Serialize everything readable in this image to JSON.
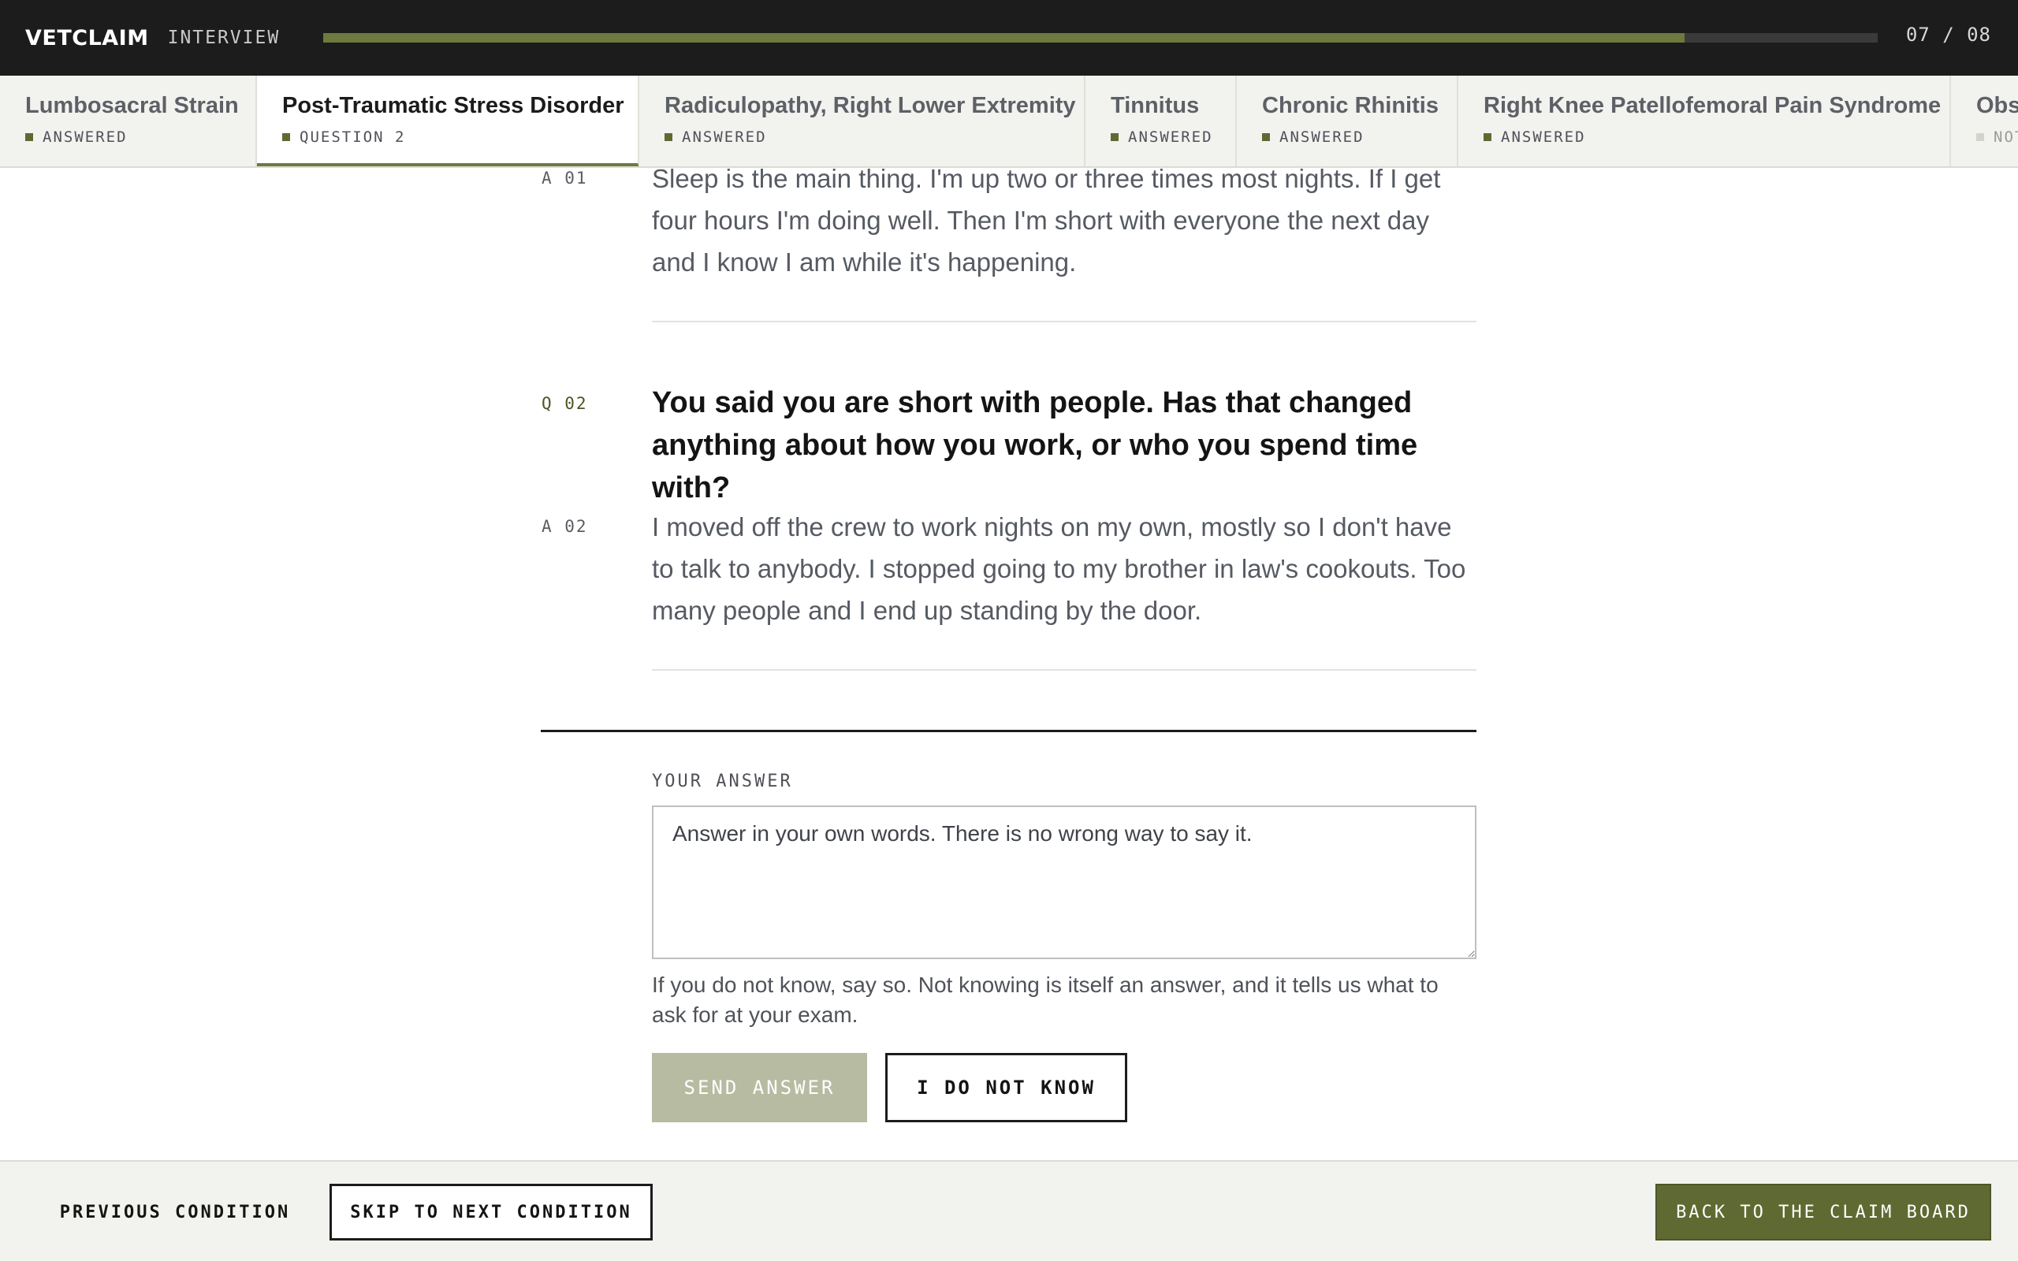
{
  "header": {
    "brand": "VETCLAIM",
    "section": "INTERVIEW",
    "progress_fraction": 0.876,
    "counter": "07 / 08"
  },
  "tabs": [
    {
      "title": "Lumbosacral Strain",
      "status": "ANSWERED"
    },
    {
      "title": "Post-Traumatic Stress Disorder",
      "status": "QUESTION 2"
    },
    {
      "title": "Radiculopathy, Right Lower Extremity",
      "status": "ANSWERED"
    },
    {
      "title": "Tinnitus",
      "status": "ANSWERED"
    },
    {
      "title": "Chronic Rhinitis",
      "status": "ANSWERED"
    },
    {
      "title": "Right Knee Patellofemoral Pain Syndrome",
      "status": "ANSWERED"
    },
    {
      "title": "Obs",
      "status": "NOT"
    }
  ],
  "transcript": {
    "a1_label": "A 01",
    "a1_text": "Sleep is the main thing. I'm up two or three times most nights. If I get four hours I'm doing well. Then I'm short with everyone the next day and I know I am while it's happening.",
    "q2_label": "Q 02",
    "q2_text": "You said you are short with people. Has that changed anything about how you work, or who you spend time with?",
    "a2_label": "A 02",
    "a2_text": "I moved off the crew to work nights on my own, mostly so I don't have to talk to anybody. I stopped going to my brother in law's cookouts. Too many people and I end up standing by the door."
  },
  "form": {
    "label": "YOUR ANSWER",
    "placeholder": "Answer in your own words. There is no wrong way to say it.",
    "hint": "If you do not know, say so. Not knowing is itself an answer, and it tells us what to ask for at your exam.",
    "send_label": "SEND ANSWER",
    "idk_label": "I DO NOT KNOW"
  },
  "footer": {
    "prev_label": "PREVIOUS CONDITION",
    "skip_label": "SKIP TO NEXT CONDITION",
    "back_label": "BACK TO THE CLAIM BOARD"
  },
  "colors": {
    "accent": "#6e7a3d",
    "dark": "#1c1c1c",
    "send_disabled": "#b7bba1"
  }
}
